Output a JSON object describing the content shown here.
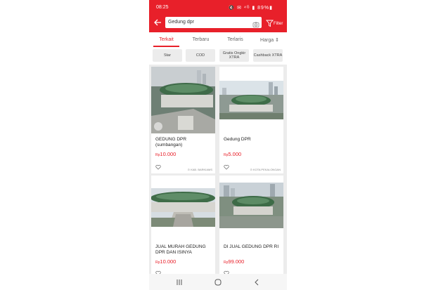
{
  "status": {
    "time": "08:25",
    "indicators": "🔇 ✉ ⁴ᴳ ▮ 89%▮"
  },
  "search": {
    "query": "Gedung dpr"
  },
  "filter": {
    "label": "Filter"
  },
  "tabs": [
    {
      "label": "Terkait"
    },
    {
      "label": "Terbaru"
    },
    {
      "label": "Terlaris"
    },
    {
      "label": "Harga ⇕"
    }
  ],
  "chips": [
    {
      "label": "Star"
    },
    {
      "label": "COD"
    },
    {
      "label": "Gratis Ongkir XTRA"
    },
    {
      "label": "Cashback XTRA"
    }
  ],
  "products": [
    {
      "name": "GEDUNG DPR (sumbangan)",
      "currency": "Rp",
      "price": "10.000",
      "location": "KAB. BARKIAMS"
    },
    {
      "name": "Gedung DPR",
      "currency": "Rp",
      "price": "5.000",
      "location": "KOTA PEKALONGAN"
    },
    {
      "name": "JUAL MURAH GEDUNG DPR DAN ISINYA",
      "currency": "Rp",
      "price": "10.000",
      "location": ""
    },
    {
      "name": "DI JUAL GEDUNG DPR RI",
      "currency": "Rp",
      "price": "99.000",
      "location": ""
    }
  ],
  "colors": {
    "brand": "#e8202a",
    "dome": "#4a7d58"
  }
}
